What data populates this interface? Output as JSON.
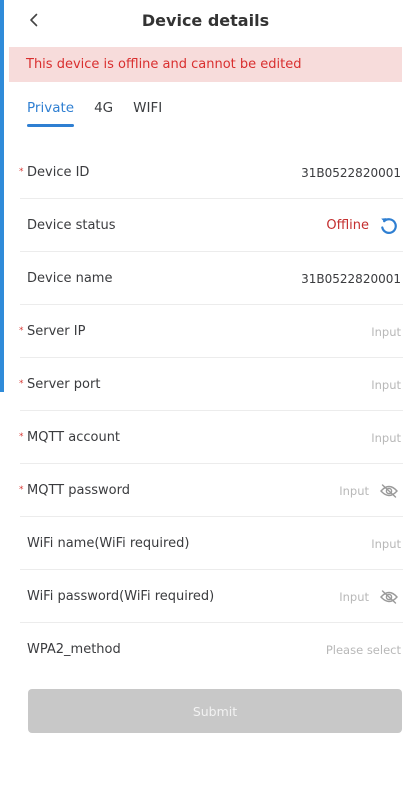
{
  "header": {
    "title": "Device details",
    "back_icon": "chevron-left-icon"
  },
  "banner": {
    "text": "This device is offline and cannot be edited",
    "background": "#f7dcdb",
    "color": "#d92f2f"
  },
  "tabs": [
    {
      "label": "Private",
      "active": true
    },
    {
      "label": "4G",
      "active": false
    },
    {
      "label": "WIFI",
      "active": false
    }
  ],
  "form": {
    "device_id": {
      "label": "Device ID",
      "required": "*",
      "value": "31B0522820001"
    },
    "device_status": {
      "label": "Device status",
      "value": "Offline",
      "icon": "refresh-icon"
    },
    "device_name": {
      "label": "Device name",
      "value": "31B0522820001"
    },
    "server_ip": {
      "label": "Server IP",
      "required": "*",
      "placeholder": "Input"
    },
    "server_port": {
      "label": "Server port",
      "required": "*",
      "placeholder": "Input"
    },
    "mqtt_account": {
      "label": "MQTT account",
      "required": "*",
      "placeholder": "Input"
    },
    "mqtt_password": {
      "label": "MQTT password",
      "required": "*",
      "placeholder": "Input",
      "icon": "eye-off-icon"
    },
    "wifi_name": {
      "label": "WiFi name(WiFi required)",
      "placeholder": "Input"
    },
    "wifi_password": {
      "label": "WiFi password(WiFi required)",
      "placeholder": "Input",
      "icon": "eye-off-icon"
    },
    "wpa2_method": {
      "label": "WPA2_method",
      "placeholder": "Please select"
    }
  },
  "submit": {
    "label": "Submit",
    "disabled_color": "#c8c8c8"
  },
  "colors": {
    "accent": "#2f7fd2",
    "offline": "#c42f2f",
    "required": "#d73b36"
  }
}
